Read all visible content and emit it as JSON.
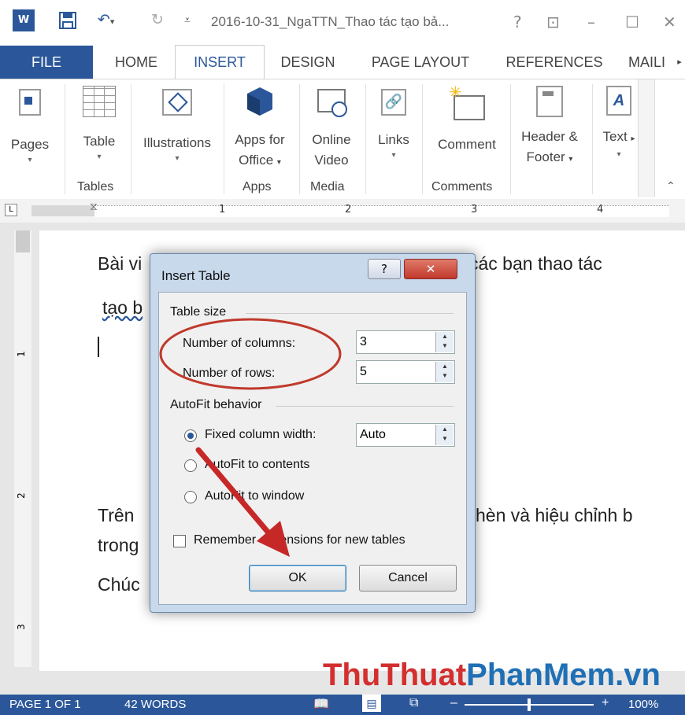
{
  "titlebar": {
    "title": "2016-10-31_NgaTTN_Thao tác tạo bả...",
    "help": "?",
    "restore": "⊡",
    "minimize": "–",
    "maximize": "☐",
    "close": "✕"
  },
  "tabs": [
    "FILE",
    "HOME",
    "INSERT",
    "DESIGN",
    "PAGE LAYOUT",
    "REFERENCES",
    "MAILI"
  ],
  "ribbon": {
    "pages": "Pages",
    "table": "Table",
    "illustrations": "Illustrations",
    "apps_line1": "Apps for",
    "apps_line2": "Office",
    "video_line1": "Online",
    "video_line2": "Video",
    "links": "Links",
    "comment": "Comment",
    "header_line1": "Header &",
    "header_line2": "Footer",
    "text": "Text",
    "groups": {
      "tables": "Tables",
      "apps": "Apps",
      "media": "Media",
      "comments": "Comments"
    }
  },
  "ruler": {
    "marks": [
      "1",
      "2",
      "3",
      "4"
    ],
    "v_marks": [
      "1",
      "2",
      "3"
    ]
  },
  "document": {
    "line1_start": "Bài vi",
    "line1_end": "các bạn thao tác",
    "line2": "tạo b",
    "line3_start": "Trên",
    "line3_end": "hèn và hiệu chỉnh b",
    "line4": "trong",
    "line5": "Chúc"
  },
  "dialog": {
    "title": "Insert Table",
    "help": "?",
    "close": "✕",
    "table_size": "Table size",
    "columns_label": "Number of columns:",
    "columns_value": "3",
    "rows_label": "Number of rows:",
    "rows_value": "5",
    "autofit_behavior": "AutoFit behavior",
    "fixed_label": "Fixed column width:",
    "fixed_value": "Auto",
    "autofit_contents": "AutoFit to contents",
    "autofit_window": "AutoFit to window",
    "remember": "Remember dimensions for new tables",
    "ok": "OK",
    "cancel": "Cancel"
  },
  "statusbar": {
    "page": "PAGE 1 OF 1",
    "words": "42 WORDS",
    "zoom": "100%",
    "zoom_minus": "–",
    "zoom_plus": "+"
  },
  "watermark": {
    "part1": "ThuThuat",
    "part2": "PhanMem",
    "part3": ".vn"
  },
  "colors": {
    "accent": "#2b579a",
    "arrow": "#c62828",
    "ellipse": "#c0392b"
  }
}
